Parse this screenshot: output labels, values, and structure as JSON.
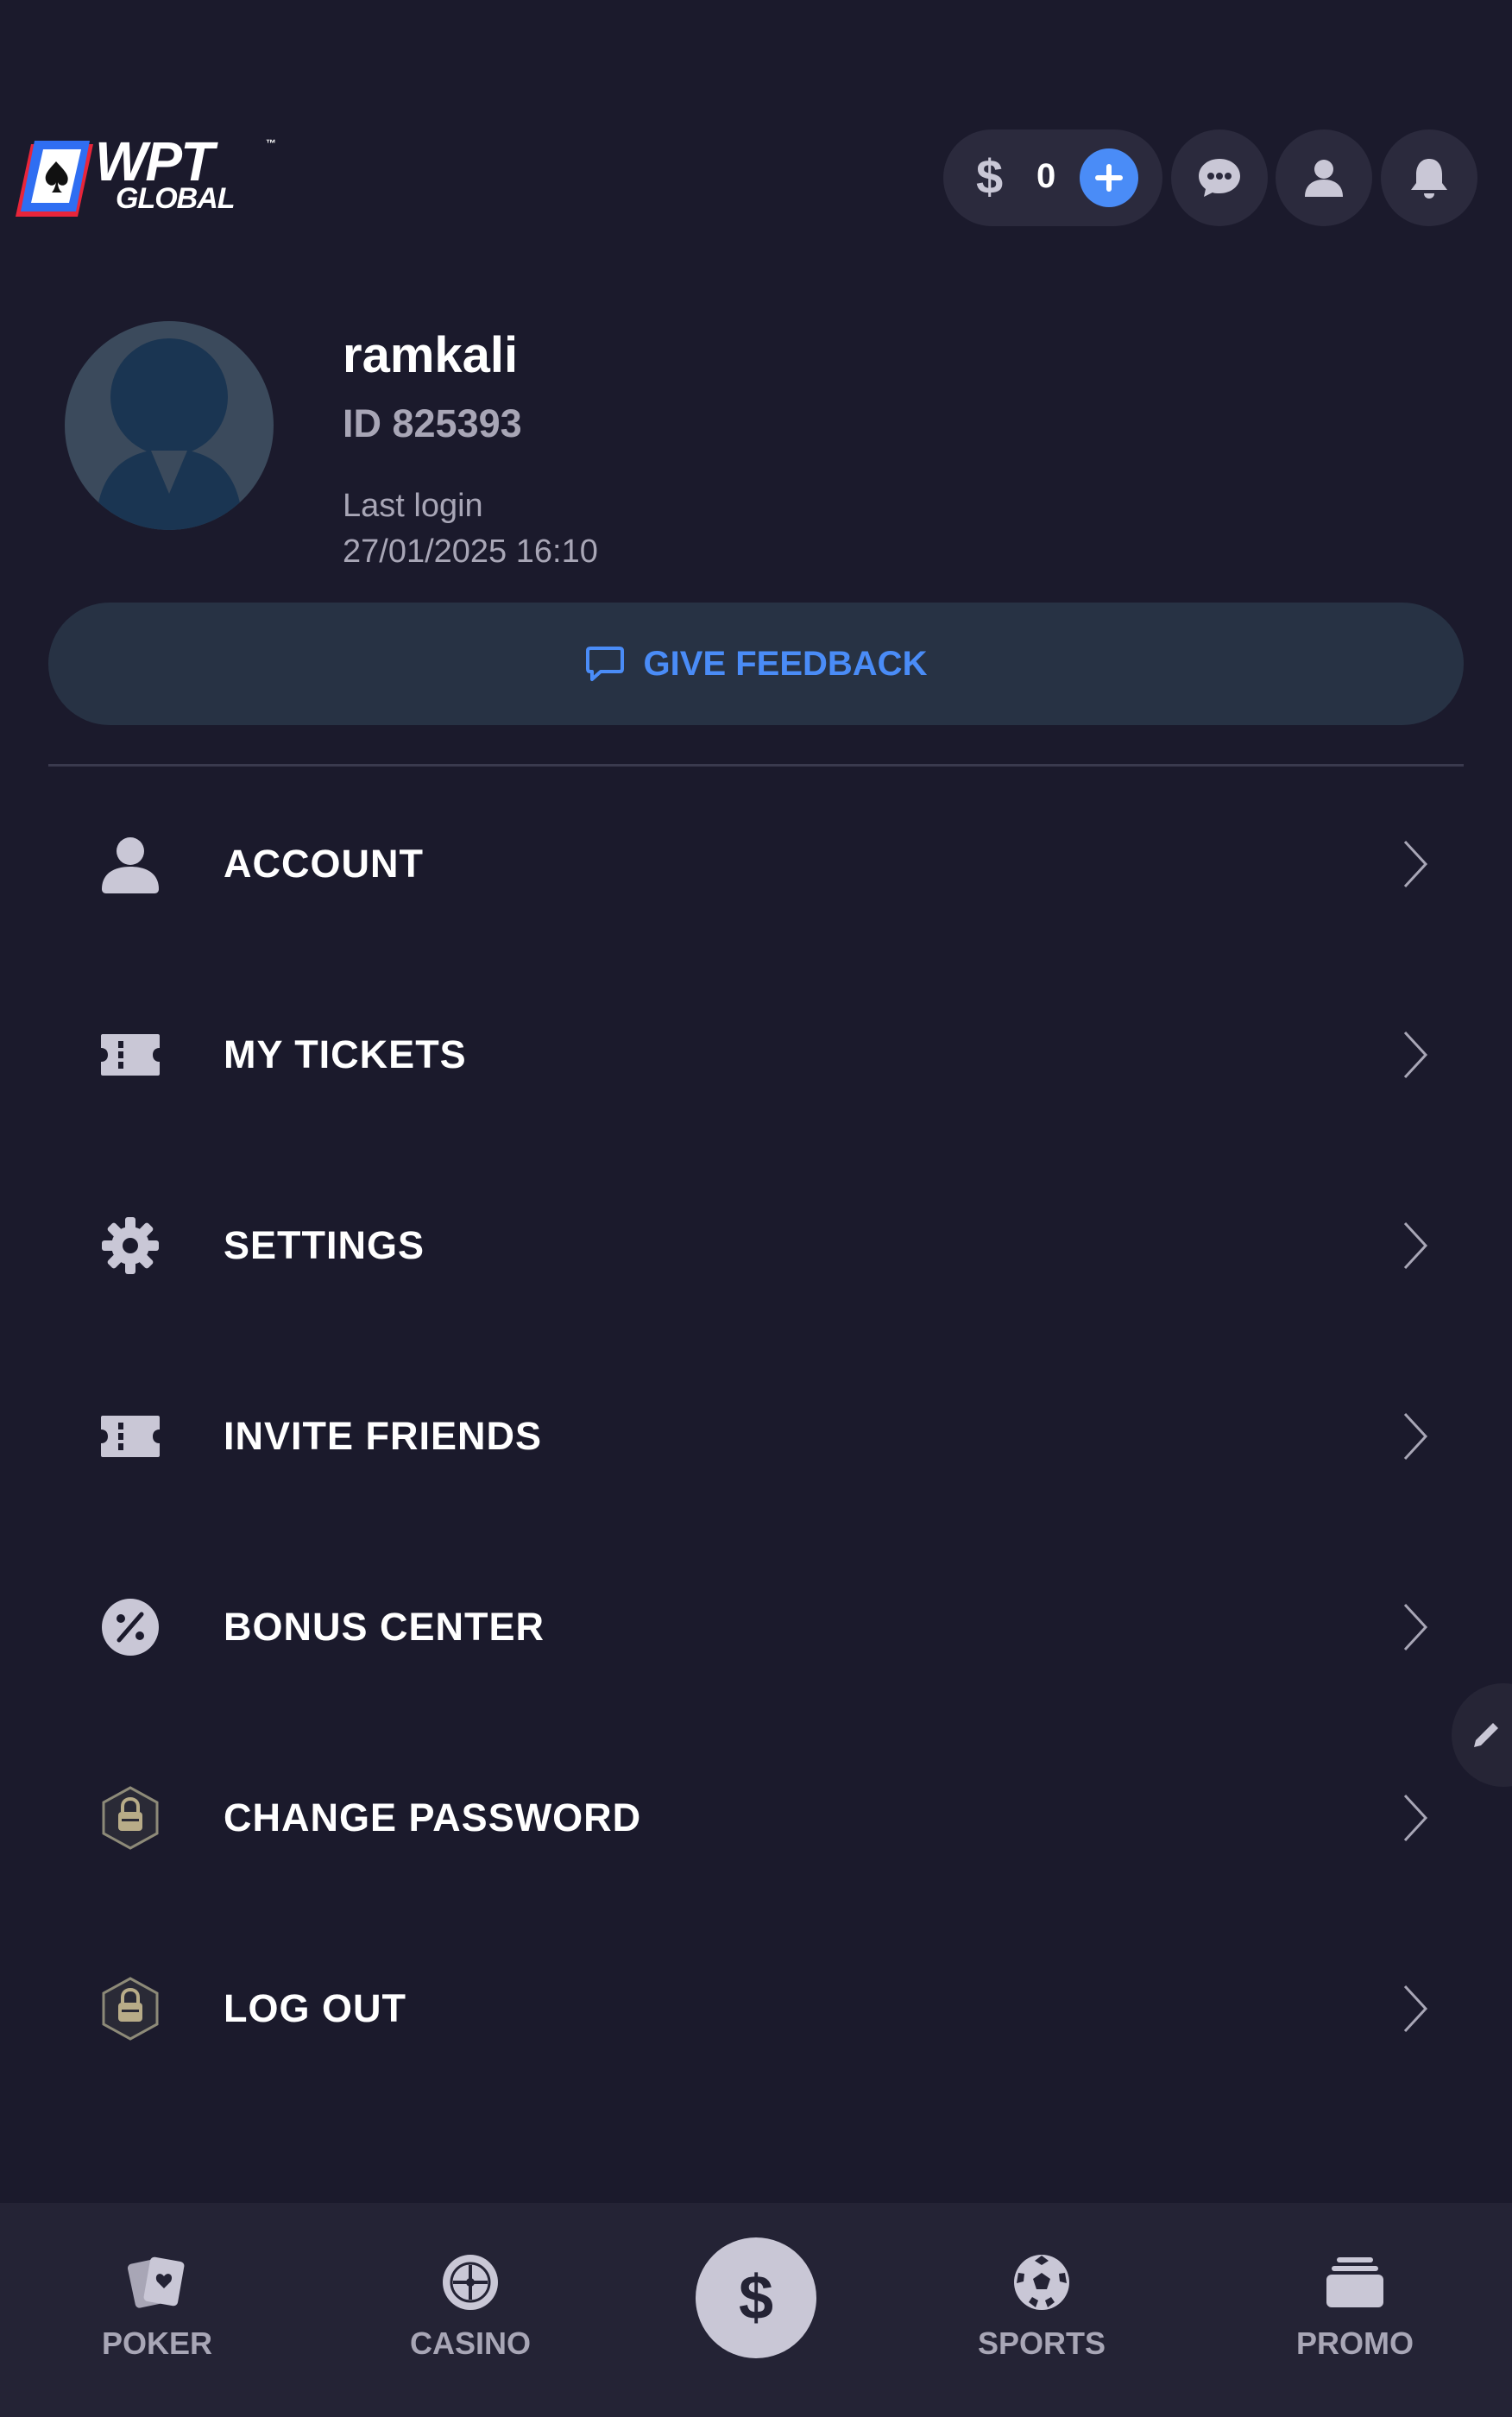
{
  "header": {
    "logo_line1": "WPT",
    "logo_line2": "GLOBAL",
    "logo_tm": "™",
    "currency_symbol": "$",
    "balance": "0"
  },
  "profile": {
    "username": "ramkali",
    "user_id": "ID 825393",
    "last_login_label": "Last login",
    "last_login_time": "27/01/2025 16:10"
  },
  "feedback": {
    "label": "GIVE FEEDBACK"
  },
  "menu": {
    "items": [
      {
        "label": "ACCOUNT",
        "icon": "user-icon"
      },
      {
        "label": "MY TICKETS",
        "icon": "ticket-icon"
      },
      {
        "label": "SETTINGS",
        "icon": "gear-icon"
      },
      {
        "label": "INVITE FRIENDS",
        "icon": "ticket-icon"
      },
      {
        "label": "BONUS CENTER",
        "icon": "percent-icon"
      },
      {
        "label": "CHANGE PASSWORD",
        "icon": "lock-badge-icon"
      },
      {
        "label": "LOG OUT",
        "icon": "lock-badge-icon"
      }
    ]
  },
  "bottom_nav": {
    "items": [
      {
        "label": "POKER",
        "icon": "cards-icon"
      },
      {
        "label": "CASINO",
        "icon": "roulette-icon"
      },
      {
        "label": "SPORTS",
        "icon": "soccer-ball-icon"
      },
      {
        "label": "PROMO",
        "icon": "promo-stack-icon"
      }
    ],
    "center_symbol": "$"
  },
  "colors": {
    "background": "#1b1a2c",
    "accent": "#4a8cf7",
    "surface": "#2b2a3d",
    "muted_text": "#a8a6b6"
  }
}
